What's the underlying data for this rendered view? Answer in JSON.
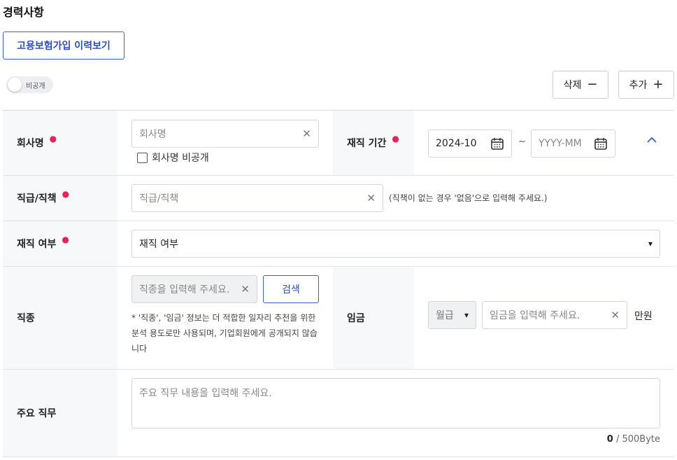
{
  "section_title": "경력사항",
  "insurance_button": "고용보험가입 이력보기",
  "privacy_toggle": {
    "label": "비공개"
  },
  "actions": {
    "delete_label": "삭제",
    "delete_symbol": "−",
    "add_label": "추가",
    "add_symbol": "+"
  },
  "form": {
    "company": {
      "label": "회사명",
      "placeholder": "회사명",
      "private_checkbox_label": "회사명 비공개"
    },
    "period": {
      "label": "재직 기간",
      "start_value": "2024-10",
      "separator": "~",
      "end_placeholder": "YYYY-MM"
    },
    "position": {
      "label": "직급/직책",
      "placeholder": "직급/직책",
      "hint": "(직책이 없는 경우 '없음'으로 입력해 주세요.)"
    },
    "status": {
      "label": "재직 여부",
      "selected": "재직 여부"
    },
    "job_type": {
      "label": "직종",
      "placeholder": "직종을 입력해 주세요.",
      "search_label": "검색",
      "notice": "* '직종', '임금' 정보는 더 적합한 일자리 추천을 위한 분석 용도로만 사용되며, 기업회원에게 공개되지 않습니다"
    },
    "salary": {
      "label": "임금",
      "type_selected": "월급",
      "placeholder": "임금을 입력해 주세요.",
      "unit": "만원"
    },
    "duties": {
      "label": "주요 직무",
      "placeholder": "주요 직무 내용을 입력해 주세요.",
      "count": "0",
      "limit": "/ 500Byte"
    }
  },
  "colors": {
    "accent": "#2d4fc0",
    "required": "#e6245a",
    "label_bg": "#f7f8fa"
  }
}
